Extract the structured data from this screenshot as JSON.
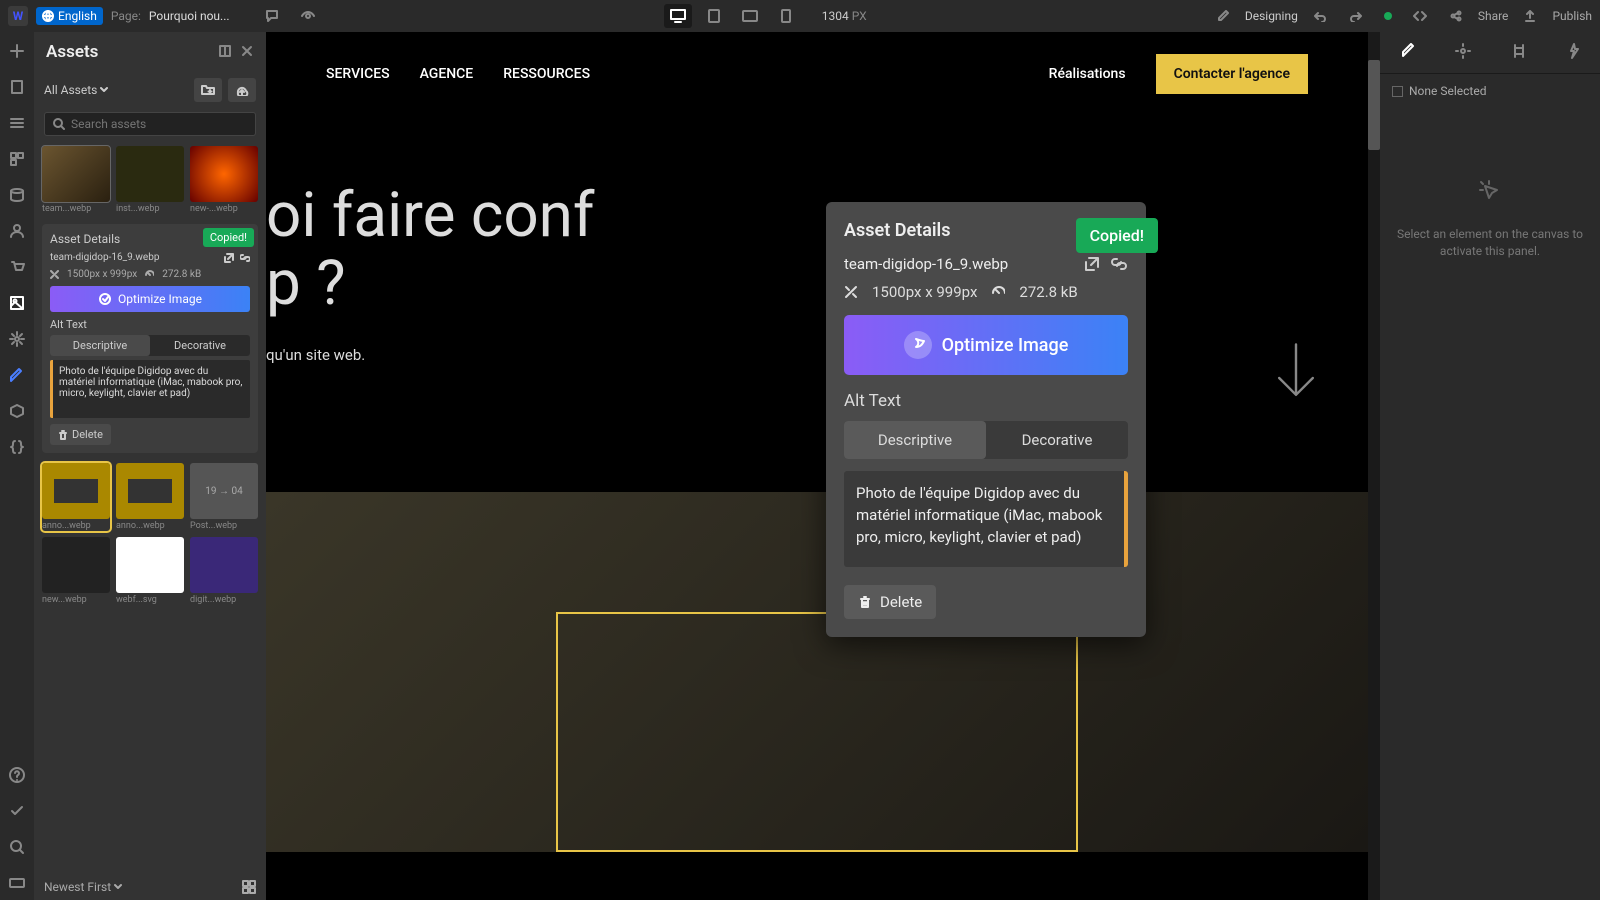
{
  "topbar": {
    "language": "English",
    "page_prefix": "Page:",
    "page_name": "Pourquoi nou...",
    "viewport_width": "1304",
    "viewport_unit": "PX",
    "mode": "Designing",
    "share": "Share",
    "publish": "Publish"
  },
  "assets": {
    "title": "Assets",
    "filter": "All Assets",
    "search_placeholder": "Search assets",
    "sort": "Newest First",
    "items": [
      {
        "label": "team...webp"
      },
      {
        "label": "inst...webp"
      },
      {
        "label": "new-...webp"
      },
      {
        "label": "anno...webp"
      },
      {
        "label": "anno...webp"
      },
      {
        "label": "Post...webp"
      },
      {
        "label": "new...webp"
      },
      {
        "label": "webf...svg"
      },
      {
        "label": "digit...webp"
      }
    ]
  },
  "details": {
    "title": "Asset Details",
    "copied": "Copied!",
    "filename": "team-digidop-16_9.webp",
    "dimensions": "1500px x 999px",
    "filesize": "272.8 kB",
    "optimize": "Optimize Image",
    "alt_label": "Alt Text",
    "tab_descriptive": "Descriptive",
    "tab_decorative": "Decorative",
    "alt_value": "Photo de l'équipe Digidop avec du matériel informatique (iMac, mabook pro, micro, keylight, clavier et pad)",
    "delete": "Delete"
  },
  "site": {
    "nav": {
      "services": "SERVICES",
      "agence": "AGENCE",
      "ressources": "RESSOURCES",
      "realisations": "Réalisations",
      "cta": "Contacter l'agence"
    },
    "hero_line1": "oi faire conf",
    "hero_line2": "p ?",
    "hero_sub": "qu'un site web."
  },
  "rpanel": {
    "none_selected": "None Selected",
    "empty": "Select an element on the canvas to activate this panel."
  }
}
